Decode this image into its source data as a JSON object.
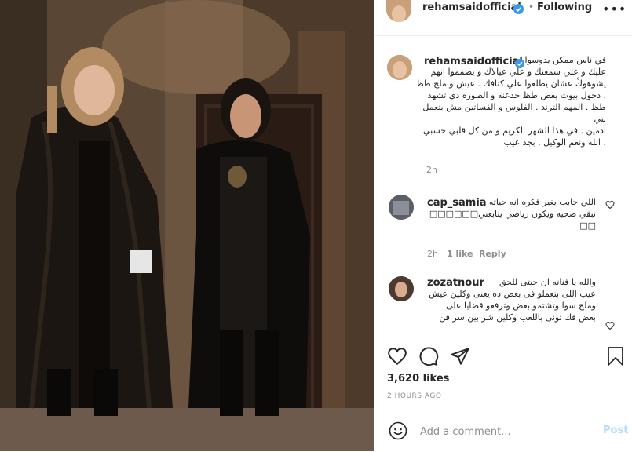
{
  "header": {
    "username": "rehamsaidofficial",
    "dot": "•",
    "follow_status": "Following",
    "more_icon": "ellipsis-icon"
  },
  "caption": {
    "username": "rehamsaidofficial",
    "lines": [
      "في ناس ممكن يدوسوا",
      "عليك و علي سمعتك و علي عيالاك و يصمموا انهم",
      "يشوهوكْ عشان يطلعوا علي كتافك . عيش و ملح طظ",
      ". دخول بيوت بعض طظ جدعنه و الصوره دي تشهد",
      "طظ . المهم الترند . الفلوس و الفساتين مش بتعمل بني",
      "ادمين . في هذا الشهر الكريم و من كل قلبي حسبي",
      ". الله ونعم الوكيل . بجد عيب"
    ],
    "time": "2h"
  },
  "comments": [
    {
      "username": "cap_samia",
      "lines": [
        "اللي حابب يغير فكره انه حياته",
        "تبقي صحيه ويكون رياضي يتابعني□□□□□□",
        "□□"
      ],
      "time": "2h",
      "likes": "1 like",
      "reply": "Reply"
    },
    {
      "username": "zozatnour",
      "lines": [
        "والله يا فنانه ان جيتى للحق",
        "عيب اللى بتعملو فى بعض ده يعنى وكلين عيش",
        "وملح سوا وتشتمو بعض وترفعو قضايا على",
        "بعض فك تونى باللعب وكلين شر بين سر قن"
      ]
    }
  ],
  "actions": {
    "like_icon": "heart-icon",
    "comment_icon": "comment-icon",
    "share_icon": "share-icon",
    "save_icon": "bookmark-icon",
    "likes_count": "3,620 likes",
    "posted_time": "2 HOURS AGO"
  },
  "add_comment": {
    "placeholder": "Add a comment...",
    "post_label": "Post",
    "emoji_icon": "smiley-icon"
  },
  "colors": {
    "link_blue": "#0095f6",
    "post_disabled": "#b3dbff",
    "muted": "#8e8e8e",
    "text": "#262626"
  }
}
